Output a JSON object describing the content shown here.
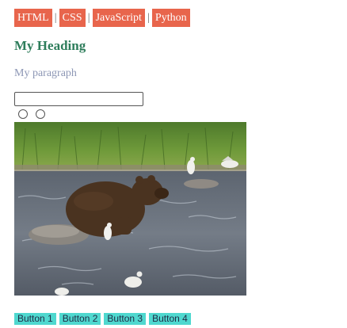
{
  "nav": {
    "links": [
      {
        "label": "HTML"
      },
      {
        "label": "CSS"
      },
      {
        "label": "JavaScript"
      },
      {
        "label": "Python"
      }
    ],
    "separator": "|"
  },
  "heading": "My Heading",
  "paragraph": "My paragraph",
  "text_input": {
    "value": "",
    "placeholder": ""
  },
  "radios": [
    {
      "checked": false
    },
    {
      "checked": false
    }
  ],
  "video": {
    "subject": "brown bear sitting in river with seagulls"
  },
  "buttons": [
    {
      "label": "Button 1"
    },
    {
      "label": "Button 2"
    },
    {
      "label": "Button 3"
    },
    {
      "label": "Button 4"
    }
  ],
  "colors": {
    "nav_bg": "#e8654c",
    "heading": "#2e7d5b",
    "paragraph": "#8d97b5",
    "button_bg": "#4fd8cf"
  }
}
